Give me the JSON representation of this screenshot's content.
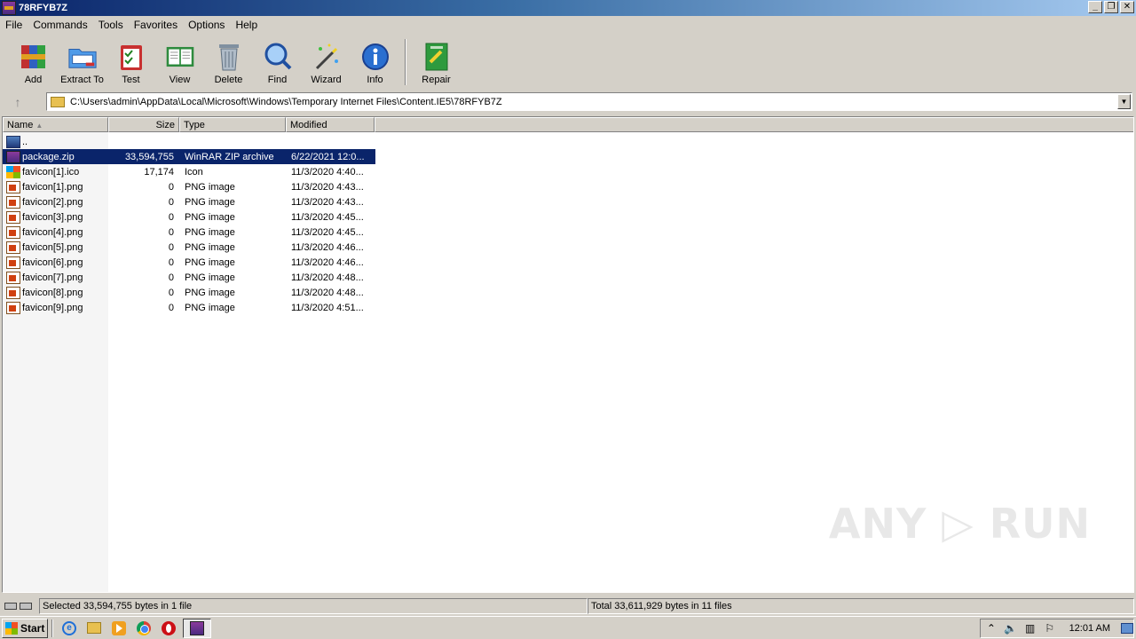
{
  "window": {
    "title": "78RFYB7Z",
    "controls": [
      "_",
      "❐",
      "✕"
    ]
  },
  "menu": [
    "File",
    "Commands",
    "Tools",
    "Favorites",
    "Options",
    "Help"
  ],
  "toolbar": [
    {
      "label": "Add",
      "icon": "add-archive-icon"
    },
    {
      "label": "Extract To",
      "icon": "extract-folder-icon"
    },
    {
      "label": "Test",
      "icon": "test-clipboard-icon"
    },
    {
      "label": "View",
      "icon": "view-book-icon"
    },
    {
      "label": "Delete",
      "icon": "trash-icon"
    },
    {
      "label": "Find",
      "icon": "magnifier-icon"
    },
    {
      "label": "Wizard",
      "icon": "wand-icon"
    },
    {
      "label": "Info",
      "icon": "info-icon"
    },
    {
      "label": "Repair",
      "icon": "repair-kit-icon"
    }
  ],
  "address": {
    "path": "C:\\Users\\admin\\AppData\\Local\\Microsoft\\Windows\\Temporary Internet Files\\Content.IE5\\78RFYB7Z"
  },
  "columns": {
    "name": "Name",
    "size": "Size",
    "type": "Type",
    "modified": "Modified"
  },
  "files": [
    {
      "name": "..",
      "size": "",
      "type": "",
      "modified": "",
      "icon": "up-folder-icon",
      "selected": false
    },
    {
      "name": "package.zip",
      "size": "33,594,755",
      "type": "WinRAR ZIP archive",
      "modified": "6/22/2021 12:0...",
      "icon": "zip-icon",
      "selected": true
    },
    {
      "name": "favicon[1].ico",
      "size": "17,174",
      "type": "Icon",
      "modified": "11/3/2020 4:40...",
      "icon": "ico-file-icon",
      "selected": false
    },
    {
      "name": "favicon[1].png",
      "size": "0",
      "type": "PNG image",
      "modified": "11/3/2020 4:43...",
      "icon": "png-file-icon",
      "selected": false
    },
    {
      "name": "favicon[2].png",
      "size": "0",
      "type": "PNG image",
      "modified": "11/3/2020 4:43...",
      "icon": "png-file-icon",
      "selected": false
    },
    {
      "name": "favicon[3].png",
      "size": "0",
      "type": "PNG image",
      "modified": "11/3/2020 4:45...",
      "icon": "png-file-icon",
      "selected": false
    },
    {
      "name": "favicon[4].png",
      "size": "0",
      "type": "PNG image",
      "modified": "11/3/2020 4:45...",
      "icon": "png-file-icon",
      "selected": false
    },
    {
      "name": "favicon[5].png",
      "size": "0",
      "type": "PNG image",
      "modified": "11/3/2020 4:46...",
      "icon": "png-file-icon",
      "selected": false
    },
    {
      "name": "favicon[6].png",
      "size": "0",
      "type": "PNG image",
      "modified": "11/3/2020 4:46...",
      "icon": "png-file-icon",
      "selected": false
    },
    {
      "name": "favicon[7].png",
      "size": "0",
      "type": "PNG image",
      "modified": "11/3/2020 4:48...",
      "icon": "png-file-icon",
      "selected": false
    },
    {
      "name": "favicon[8].png",
      "size": "0",
      "type": "PNG image",
      "modified": "11/3/2020 4:48...",
      "icon": "png-file-icon",
      "selected": false
    },
    {
      "name": "favicon[9].png",
      "size": "0",
      "type": "PNG image",
      "modified": "11/3/2020 4:51...",
      "icon": "png-file-icon",
      "selected": false
    }
  ],
  "status": {
    "left": "Selected 33,594,755 bytes in 1 file",
    "right": "Total 33,611,929 bytes in 11 files"
  },
  "watermark": "ANY ▷ RUN",
  "taskbar": {
    "start_label": "Start",
    "clock": "12:01 AM"
  },
  "colors": {
    "selection": "#0a246a",
    "face": "#d4d0c8"
  }
}
